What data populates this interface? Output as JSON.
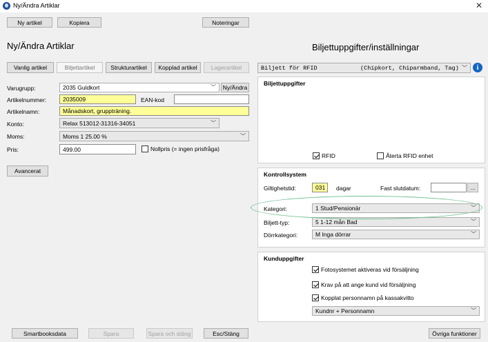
{
  "window": {
    "title": "Ny/Ändra Artiklar",
    "close_symbol": "✕"
  },
  "toolbar": {
    "new_article": "Ny artikel",
    "copy": "Kopiera",
    "notes": "Noteringar"
  },
  "left": {
    "heading": "Ny/Ändra Artiklar",
    "tabs": [
      "Vanlig artikel",
      "Biljettartikel",
      "Strukturartikel",
      "Kopplad artikel",
      "Lagerartikel"
    ],
    "labels": {
      "group": "Varugrupp:",
      "article_number": "Artikelnummer:",
      "ean": "EAN-kod",
      "article_name": "Artikelnamn:",
      "account": "Konto:",
      "vat": "Moms:",
      "price": "Pris:"
    },
    "values": {
      "group": "2035 Guldkort",
      "article_number": "2035009",
      "ean": "",
      "article_name": "Månadskort, gruppträning.",
      "account": "Relax 513012-31316-34051",
      "vat": "Moms 1 25.00 %",
      "price": "499.00"
    },
    "new_change_button": "Ny/Ändra",
    "zero_price": {
      "label": "Nollpris (= ingen prisfråga)",
      "checked": false
    },
    "advanced_button": "Avancerat"
  },
  "right": {
    "heading": "Biljettuppgifter/inställningar",
    "ticket_type": {
      "left": "Biljett för RFID",
      "right": "(Chipkort, Chiparmband, Tag)"
    },
    "ticket_info": {
      "title": "Biljettuppgifter",
      "rfid": {
        "label": "RFID",
        "checked": true
      },
      "return_rfid": {
        "label": "Återta RFID enhet",
        "checked": false
      }
    },
    "control": {
      "title": "Kontrollsystem",
      "validity_label": "Giltighetstid:",
      "validity_value": "031",
      "days_label": "dagar",
      "fixed_end_label": "Fast slutdatum:",
      "fixed_end_value": "",
      "browse": "...",
      "category_label": "Kategori:",
      "category_value": "1 Stud/Pensionär",
      "ticket_kind_label": "Biljett-typ:",
      "ticket_kind_value": "5 1-12 mån Bad",
      "door_label": "Dörrkategori:",
      "door_value": "M Inga dörrar"
    },
    "customer": {
      "title": "Kunduppgifter",
      "photo": {
        "label": "Fotosystemet aktiveras vid försäljning",
        "checked": true
      },
      "require": {
        "label": "Krav på att ange kund vid försäljning",
        "checked": true
      },
      "linked": {
        "label": "Kopplat personnamn på kassakvitto",
        "checked": true
      },
      "name_select": "Kundnr + Personnamn"
    }
  },
  "footer": {
    "smartbooks": "Smartbooksdata",
    "save": "Spara",
    "save_close": "Spara och stäng",
    "esc_close": "Esc/Stäng",
    "other": "Övriga funktioner"
  },
  "icons": {
    "dropdown": "chevron-down-icon",
    "info": "info-icon",
    "app": "app-logo-icon"
  },
  "colors": {
    "required_field": "#ffff99",
    "info": "#1565c0",
    "highlight": "#6dbf8f"
  }
}
